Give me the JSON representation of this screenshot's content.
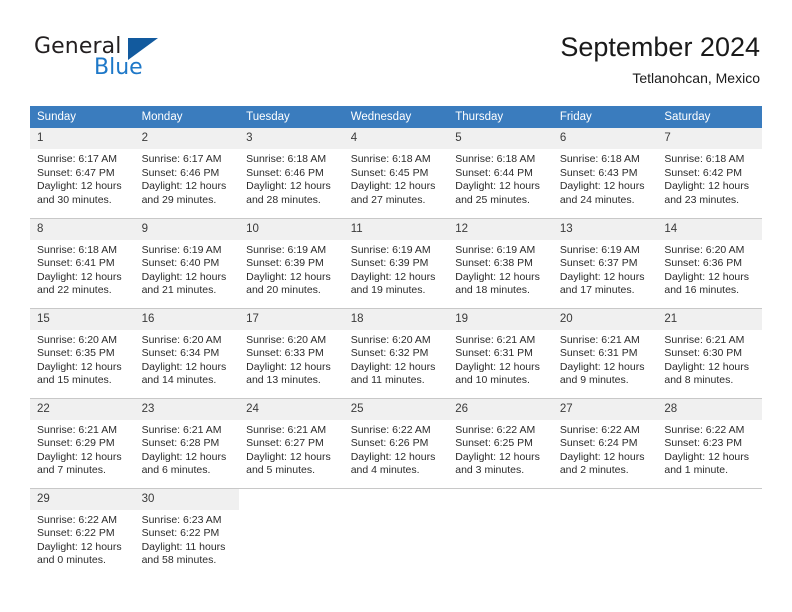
{
  "brand": {
    "name_top": "General",
    "name_bottom": "Blue",
    "color_dark": "#231f20",
    "color_blue": "#1e78c8",
    "triangle_color": "#125a9e"
  },
  "header": {
    "title": "September 2024",
    "subtitle": "Tetlanohcan, Mexico"
  },
  "theme": {
    "header_bg": "#3a7cbe",
    "header_text": "#ffffff",
    "daynum_bg": "#f0f0f0",
    "grid_line": "#c8c8c8"
  },
  "weekdays": [
    "Sunday",
    "Monday",
    "Tuesday",
    "Wednesday",
    "Thursday",
    "Friday",
    "Saturday"
  ],
  "weeks": [
    [
      {
        "day": "1",
        "sunrise": "Sunrise: 6:17 AM",
        "sunset": "Sunset: 6:47 PM",
        "daylight1": "Daylight: 12 hours",
        "daylight2": "and 30 minutes."
      },
      {
        "day": "2",
        "sunrise": "Sunrise: 6:17 AM",
        "sunset": "Sunset: 6:46 PM",
        "daylight1": "Daylight: 12 hours",
        "daylight2": "and 29 minutes."
      },
      {
        "day": "3",
        "sunrise": "Sunrise: 6:18 AM",
        "sunset": "Sunset: 6:46 PM",
        "daylight1": "Daylight: 12 hours",
        "daylight2": "and 28 minutes."
      },
      {
        "day": "4",
        "sunrise": "Sunrise: 6:18 AM",
        "sunset": "Sunset: 6:45 PM",
        "daylight1": "Daylight: 12 hours",
        "daylight2": "and 27 minutes."
      },
      {
        "day": "5",
        "sunrise": "Sunrise: 6:18 AM",
        "sunset": "Sunset: 6:44 PM",
        "daylight1": "Daylight: 12 hours",
        "daylight2": "and 25 minutes."
      },
      {
        "day": "6",
        "sunrise": "Sunrise: 6:18 AM",
        "sunset": "Sunset: 6:43 PM",
        "daylight1": "Daylight: 12 hours",
        "daylight2": "and 24 minutes."
      },
      {
        "day": "7",
        "sunrise": "Sunrise: 6:18 AM",
        "sunset": "Sunset: 6:42 PM",
        "daylight1": "Daylight: 12 hours",
        "daylight2": "and 23 minutes."
      }
    ],
    [
      {
        "day": "8",
        "sunrise": "Sunrise: 6:18 AM",
        "sunset": "Sunset: 6:41 PM",
        "daylight1": "Daylight: 12 hours",
        "daylight2": "and 22 minutes."
      },
      {
        "day": "9",
        "sunrise": "Sunrise: 6:19 AM",
        "sunset": "Sunset: 6:40 PM",
        "daylight1": "Daylight: 12 hours",
        "daylight2": "and 21 minutes."
      },
      {
        "day": "10",
        "sunrise": "Sunrise: 6:19 AM",
        "sunset": "Sunset: 6:39 PM",
        "daylight1": "Daylight: 12 hours",
        "daylight2": "and 20 minutes."
      },
      {
        "day": "11",
        "sunrise": "Sunrise: 6:19 AM",
        "sunset": "Sunset: 6:39 PM",
        "daylight1": "Daylight: 12 hours",
        "daylight2": "and 19 minutes."
      },
      {
        "day": "12",
        "sunrise": "Sunrise: 6:19 AM",
        "sunset": "Sunset: 6:38 PM",
        "daylight1": "Daylight: 12 hours",
        "daylight2": "and 18 minutes."
      },
      {
        "day": "13",
        "sunrise": "Sunrise: 6:19 AM",
        "sunset": "Sunset: 6:37 PM",
        "daylight1": "Daylight: 12 hours",
        "daylight2": "and 17 minutes."
      },
      {
        "day": "14",
        "sunrise": "Sunrise: 6:20 AM",
        "sunset": "Sunset: 6:36 PM",
        "daylight1": "Daylight: 12 hours",
        "daylight2": "and 16 minutes."
      }
    ],
    [
      {
        "day": "15",
        "sunrise": "Sunrise: 6:20 AM",
        "sunset": "Sunset: 6:35 PM",
        "daylight1": "Daylight: 12 hours",
        "daylight2": "and 15 minutes."
      },
      {
        "day": "16",
        "sunrise": "Sunrise: 6:20 AM",
        "sunset": "Sunset: 6:34 PM",
        "daylight1": "Daylight: 12 hours",
        "daylight2": "and 14 minutes."
      },
      {
        "day": "17",
        "sunrise": "Sunrise: 6:20 AM",
        "sunset": "Sunset: 6:33 PM",
        "daylight1": "Daylight: 12 hours",
        "daylight2": "and 13 minutes."
      },
      {
        "day": "18",
        "sunrise": "Sunrise: 6:20 AM",
        "sunset": "Sunset: 6:32 PM",
        "daylight1": "Daylight: 12 hours",
        "daylight2": "and 11 minutes."
      },
      {
        "day": "19",
        "sunrise": "Sunrise: 6:21 AM",
        "sunset": "Sunset: 6:31 PM",
        "daylight1": "Daylight: 12 hours",
        "daylight2": "and 10 minutes."
      },
      {
        "day": "20",
        "sunrise": "Sunrise: 6:21 AM",
        "sunset": "Sunset: 6:31 PM",
        "daylight1": "Daylight: 12 hours",
        "daylight2": "and 9 minutes."
      },
      {
        "day": "21",
        "sunrise": "Sunrise: 6:21 AM",
        "sunset": "Sunset: 6:30 PM",
        "daylight1": "Daylight: 12 hours",
        "daylight2": "and 8 minutes."
      }
    ],
    [
      {
        "day": "22",
        "sunrise": "Sunrise: 6:21 AM",
        "sunset": "Sunset: 6:29 PM",
        "daylight1": "Daylight: 12 hours",
        "daylight2": "and 7 minutes."
      },
      {
        "day": "23",
        "sunrise": "Sunrise: 6:21 AM",
        "sunset": "Sunset: 6:28 PM",
        "daylight1": "Daylight: 12 hours",
        "daylight2": "and 6 minutes."
      },
      {
        "day": "24",
        "sunrise": "Sunrise: 6:21 AM",
        "sunset": "Sunset: 6:27 PM",
        "daylight1": "Daylight: 12 hours",
        "daylight2": "and 5 minutes."
      },
      {
        "day": "25",
        "sunrise": "Sunrise: 6:22 AM",
        "sunset": "Sunset: 6:26 PM",
        "daylight1": "Daylight: 12 hours",
        "daylight2": "and 4 minutes."
      },
      {
        "day": "26",
        "sunrise": "Sunrise: 6:22 AM",
        "sunset": "Sunset: 6:25 PM",
        "daylight1": "Daylight: 12 hours",
        "daylight2": "and 3 minutes."
      },
      {
        "day": "27",
        "sunrise": "Sunrise: 6:22 AM",
        "sunset": "Sunset: 6:24 PM",
        "daylight1": "Daylight: 12 hours",
        "daylight2": "and 2 minutes."
      },
      {
        "day": "28",
        "sunrise": "Sunrise: 6:22 AM",
        "sunset": "Sunset: 6:23 PM",
        "daylight1": "Daylight: 12 hours",
        "daylight2": "and 1 minute."
      }
    ],
    [
      {
        "day": "29",
        "sunrise": "Sunrise: 6:22 AM",
        "sunset": "Sunset: 6:22 PM",
        "daylight1": "Daylight: 12 hours",
        "daylight2": "and 0 minutes."
      },
      {
        "day": "30",
        "sunrise": "Sunrise: 6:23 AM",
        "sunset": "Sunset: 6:22 PM",
        "daylight1": "Daylight: 11 hours",
        "daylight2": "and 58 minutes."
      },
      {
        "day": "",
        "sunrise": "",
        "sunset": "",
        "daylight1": "",
        "daylight2": ""
      },
      {
        "day": "",
        "sunrise": "",
        "sunset": "",
        "daylight1": "",
        "daylight2": ""
      },
      {
        "day": "",
        "sunrise": "",
        "sunset": "",
        "daylight1": "",
        "daylight2": ""
      },
      {
        "day": "",
        "sunrise": "",
        "sunset": "",
        "daylight1": "",
        "daylight2": ""
      },
      {
        "day": "",
        "sunrise": "",
        "sunset": "",
        "daylight1": "",
        "daylight2": ""
      }
    ]
  ]
}
